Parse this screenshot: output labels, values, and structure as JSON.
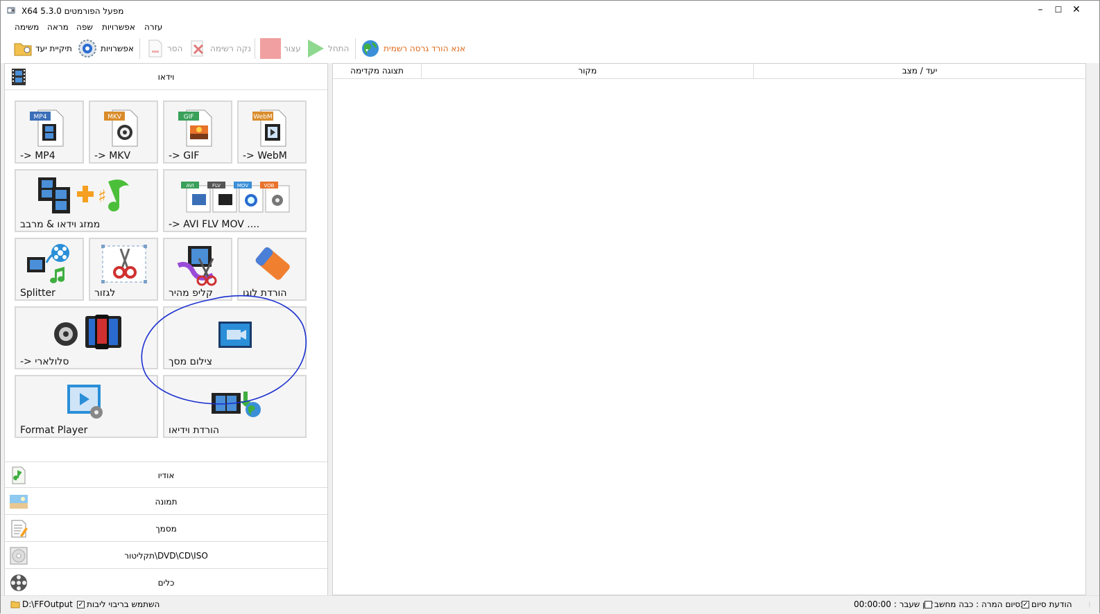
{
  "window": {
    "title": "X64 5.3.0 מפעל הפורמטים"
  },
  "menu": {
    "items": [
      "משימה",
      "מראה",
      "שפה",
      "אפשרויות",
      "עזרה"
    ]
  },
  "toolbar": {
    "output_folder": "תיקיית יעד",
    "options": "אפשרויות",
    "remove": "הסר",
    "clear_list": "נקה רשימה",
    "stop": "עצור",
    "start": "התחל",
    "download_notice": "אנא הורד גרסה רשמית"
  },
  "categories": {
    "video": "וידאו",
    "audio": "אודיו",
    "picture": "תמונה",
    "document": "מסמך",
    "rom": "תקליטור\\DVD\\CD\\ISO",
    "tools": "כלים"
  },
  "tiles": {
    "mp4": "-> MP4",
    "mkv": "-> MKV",
    "gif": "-> GIF",
    "webm": "-> WebM",
    "joiner": "ממזג וידאו & מרבב",
    "avi_flv": "-> AVI FLV MOV ....",
    "splitter": "Splitter",
    "crop": "לגזור",
    "quick_clip": "קליפ מהיר",
    "remove_logo": "הורדת לוגו",
    "mobile": "-> סלולארי",
    "screen_record": "צילום מסך",
    "format_player": "Format Player",
    "video_download": "הורדת וידיאו",
    "badge_mp4": "MP4",
    "badge_mkv": "MKV",
    "badge_gif": "GIF",
    "badge_webm": "WebM",
    "badge_avi": "AVI",
    "badge_flv": "FLV",
    "badge_mov": "MOV",
    "badge_vob": "VOB"
  },
  "table": {
    "columns": [
      "תצוגה מקדימה",
      "מקור",
      "יעד / מצב"
    ]
  },
  "status": {
    "output_path": "D:\\FFOutput",
    "multithread": "השתמש בריבוי ליבות",
    "timer": "זמן שעבר : 00:00:00",
    "after_convert": "בסיום המרה : כבה מחשב",
    "notify": "הודעת סיום"
  },
  "colors": {
    "accent_orange": "#e06a1b",
    "annotation_blue": "#1a2fd0",
    "stop_red": "#f0a0a0",
    "start_green": "#8fd88f"
  }
}
